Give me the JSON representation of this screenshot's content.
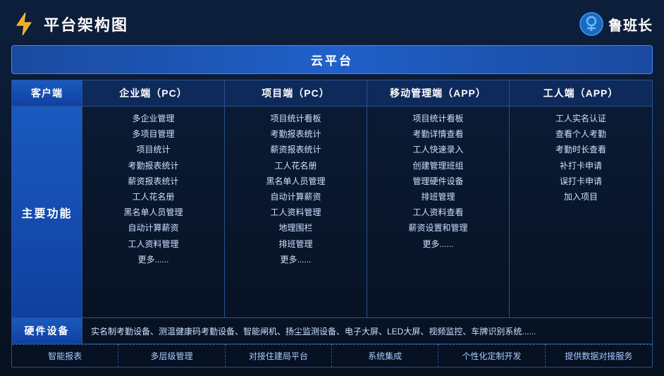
{
  "header": {
    "title": "平台架构图",
    "brand": "鲁班长"
  },
  "cloud_bar": "云平台",
  "columns": {
    "client": "客户端",
    "enterprise": "企业端（PC）",
    "project": "项目端（PC）",
    "mobile": "移动管理端（APP）",
    "worker": "工人端（APP）"
  },
  "main_function_label": "主要功能",
  "enterprise_items": [
    "多企业管理",
    "多项目管理",
    "项目统计",
    "考勤报表统计",
    "薪资报表统计",
    "工人花名册",
    "黑名单人员管理",
    "自动计算薪资",
    "工人资料管理",
    "更多......"
  ],
  "project_items": [
    "项目统计看板",
    "考勤报表统计",
    "薪资报表统计",
    "工人花名册",
    "黑名单人员管理",
    "自动计算薪资",
    "工人资料管理",
    "地理围栏",
    "排班管理",
    "更多......"
  ],
  "mobile_items": [
    "项目统计看板",
    "考勤详情查看",
    "工人快速录入",
    "创建管理班组",
    "管理硬件设备",
    "排班管理",
    "工人资料查看",
    "薪资设置和管理",
    "更多......"
  ],
  "worker_items": [
    "工人实名认证",
    "查看个人考勤",
    "考勤时长查看",
    "补打卡申请",
    "误打卡申请",
    "加入项目"
  ],
  "hardware": {
    "label": "硬件设备",
    "content": "实名制考勤设备、测温健康码考勤设备、智能闸机、扬尘监测设备、电子大屏、LED大屏、视频监控、车牌识别系统......"
  },
  "features": [
    "智能报表",
    "多层级管理",
    "对接住建局平台",
    "系统集成",
    "个性化定制开发",
    "提供数据对接服务"
  ]
}
